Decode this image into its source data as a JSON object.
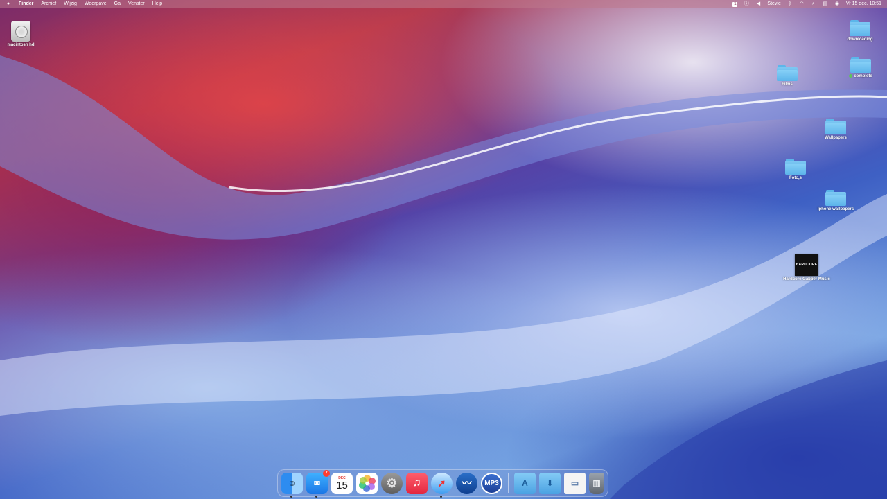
{
  "menubar": {
    "apple_icon": "apple-icon",
    "app_name": "Finder",
    "menus": [
      "Archief",
      "Wijzig",
      "Weergave",
      "Ga",
      "Venster",
      "Help"
    ],
    "status_box_label": "1",
    "user": "Stevie",
    "datetime": "Vr 15 dec. 10:51"
  },
  "desktop": {
    "hdd_label": "macintosh hd",
    "folder_top_right_label": "downloading",
    "folder_films_label": "Films",
    "folder_complete_label": "complete",
    "folder_wallpapers_label": "Wallpapers",
    "folder_fotos_label": "Foto,s",
    "folder_iphone_label": "Iphone wallpapers",
    "hardcore_label": "Hardcore Gabber Music",
    "hardcore_art_text": "HARDCORE"
  },
  "dock": {
    "mail_badge": "7",
    "calendar_month": "DEC",
    "calendar_day": "15",
    "mp3_label": "MP3"
  }
}
